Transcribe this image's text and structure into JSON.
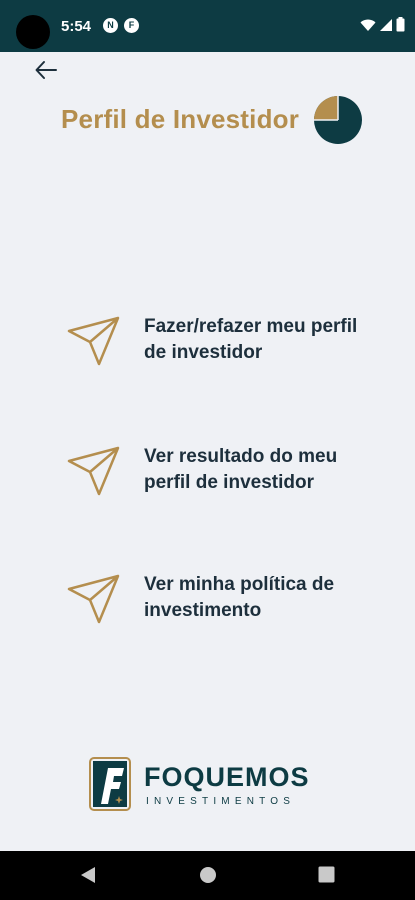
{
  "status_bar": {
    "time": "5:54",
    "notifications": [
      "N",
      "F"
    ],
    "icons": [
      "wifi-icon",
      "signal-icon",
      "battery-icon"
    ]
  },
  "header": {
    "back_icon": "arrow-left-icon",
    "title": "Perfil de Investidor",
    "title_icon": "pie-chart-icon"
  },
  "menu": {
    "items": [
      {
        "icon": "send-icon",
        "label": "Fazer/refazer meu perfil de investidor"
      },
      {
        "icon": "send-icon",
        "label": "Ver resultado do meu perfil de investidor"
      },
      {
        "icon": "send-icon",
        "label": "Ver minha política de investimento"
      }
    ]
  },
  "logo": {
    "name": "FOQUEMOS",
    "subtitle": "INVESTIMENTOS"
  },
  "nav_bar": {
    "buttons": [
      "back-triangle-icon",
      "home-circle-icon",
      "recents-square-icon"
    ]
  },
  "colors": {
    "brand_dark": "#0d3b43",
    "brand_gold": "#b48e4e",
    "text_dark": "#1d2f3c",
    "background": "#eff1f5"
  }
}
